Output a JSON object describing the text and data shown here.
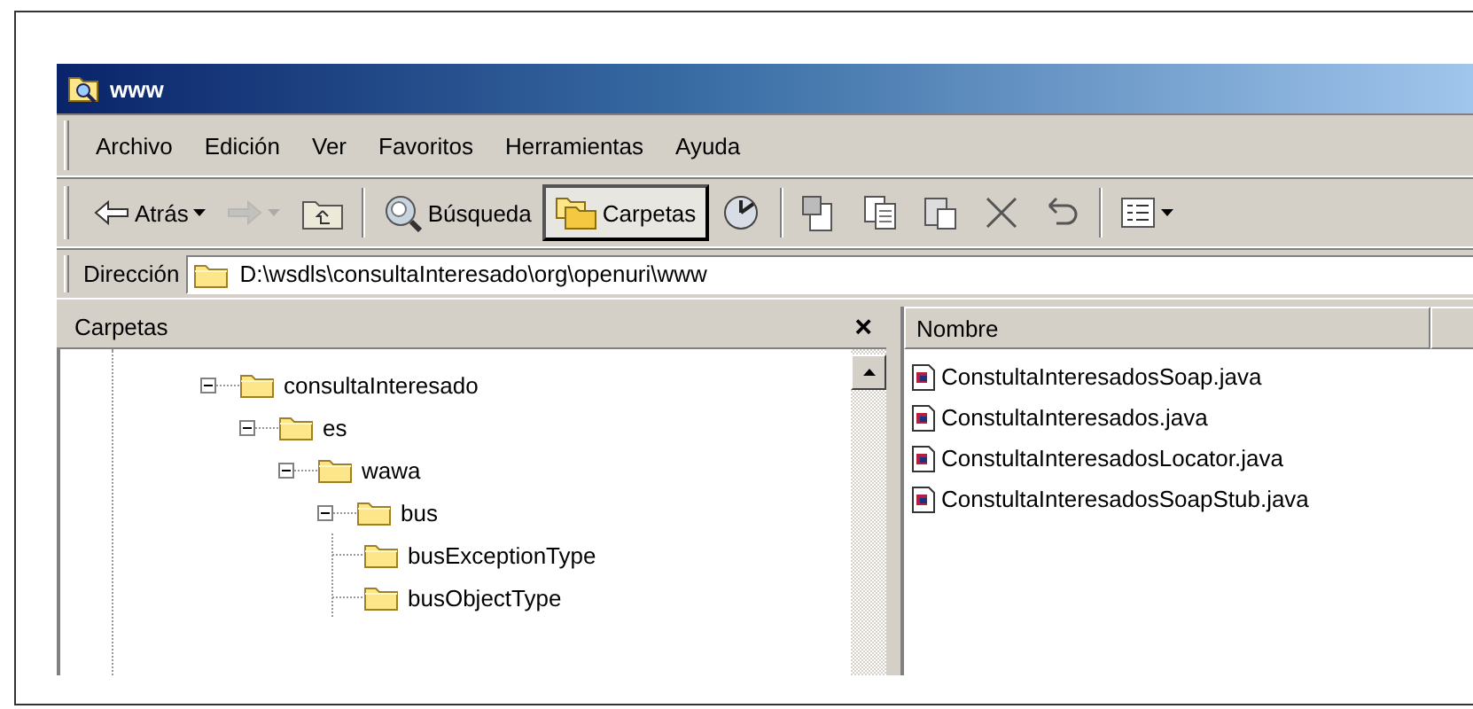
{
  "window": {
    "title": "www"
  },
  "menu": [
    {
      "label": "Archivo"
    },
    {
      "label": "Edición"
    },
    {
      "label": "Ver"
    },
    {
      "label": "Favoritos"
    },
    {
      "label": "Herramientas"
    },
    {
      "label": "Ayuda"
    }
  ],
  "toolbar": [
    {
      "kind": "back",
      "label": "Atrás",
      "disabled": false,
      "selected": false
    },
    {
      "kind": "forward",
      "disabled": true,
      "selected": false
    },
    {
      "kind": "up",
      "disabled": false,
      "selected": false
    },
    {
      "kind": "separator"
    },
    {
      "kind": "search",
      "label": "Búsqueda",
      "disabled": false,
      "selected": false
    },
    {
      "kind": "folders",
      "label": "Carpetas",
      "disabled": false,
      "selected": true
    },
    {
      "kind": "history",
      "disabled": false,
      "selected": false
    },
    {
      "kind": "separator"
    },
    {
      "kind": "move",
      "disabled": false,
      "selected": false
    },
    {
      "kind": "copy",
      "disabled": false,
      "selected": false
    },
    {
      "kind": "paste",
      "disabled": false,
      "selected": false
    },
    {
      "kind": "delete",
      "disabled": false,
      "selected": false
    },
    {
      "kind": "undo",
      "disabled": false,
      "selected": false
    },
    {
      "kind": "separator"
    },
    {
      "kind": "views",
      "disabled": false,
      "selected": false
    }
  ],
  "address": {
    "label": "Dirección",
    "value": "D:\\wsdls\\consultaInteresado\\org\\openuri\\www"
  },
  "folders_pane": {
    "title": "Carpetas",
    "close": "×",
    "tree": [
      {
        "label": "consultaInteresado",
        "expanded": true,
        "children": [
          {
            "label": "es",
            "expanded": true,
            "children": [
              {
                "label": "wawa",
                "expanded": true,
                "children": [
                  {
                    "label": "bus",
                    "expanded": true,
                    "children": [
                      {
                        "label": "busExceptionType"
                      },
                      {
                        "label": "busObjectType"
                      }
                    ]
                  }
                ]
              }
            ]
          }
        ]
      }
    ]
  },
  "file_list": {
    "columns": [
      "Nombre"
    ],
    "files": [
      {
        "name": "ConstultaInteresadosSoap.java"
      },
      {
        "name": "ConstultaInteresados.java"
      },
      {
        "name": "ConstultaInteresadosLocator.java"
      },
      {
        "name": "ConstultaInteresadosSoapStub.java"
      }
    ]
  }
}
